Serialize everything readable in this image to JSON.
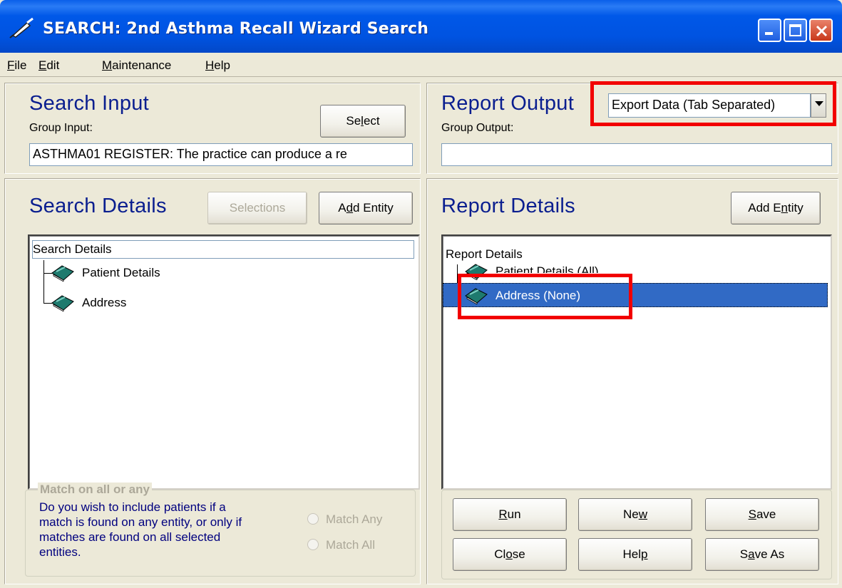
{
  "window": {
    "title": "SEARCH: 2nd Asthma Recall Wizard Search"
  },
  "menu": {
    "items": [
      {
        "label": "File",
        "mnemonic": "F",
        "rest": "ile"
      },
      {
        "label": "Edit",
        "mnemonic": "E",
        "rest": "dit"
      },
      {
        "label": "Maintenance",
        "mnemonic": "M",
        "rest": "aintenance"
      },
      {
        "label": "Help",
        "mnemonic": "H",
        "rest": "elp"
      }
    ]
  },
  "search_input": {
    "heading": "Search Input",
    "group_label": "Group Input:",
    "select_label_pre": "Se",
    "select_label_mn": "l",
    "select_label_post": "ect",
    "group_value": "ASTHMA01 REGISTER: The practice can produce a re"
  },
  "report_output": {
    "heading": "Report Output",
    "group_label": "Group Output:",
    "format_value": "Export Data (Tab Separated)",
    "group_value": ""
  },
  "search_details": {
    "heading": "Search Details",
    "selections_label": "Selections",
    "add_entity_pre": "A",
    "add_entity_mn": "d",
    "add_entity_post": "d Entity",
    "tree_root": "Search Details",
    "tree_items": [
      "Patient Details",
      "Address"
    ]
  },
  "report_details": {
    "heading": "Report Details",
    "add_entity_pre": "Add E",
    "add_entity_mn": "n",
    "add_entity_post": "tity",
    "tree_root": "Report Details",
    "tree_items": [
      "Patient Details (All)",
      "Address (None)"
    ]
  },
  "match": {
    "legend": "Match on all or any",
    "description_lines": [
      "Do you wish to include patients if a",
      "match is found on any entity, or only if",
      "matches are found on all selected",
      "entities."
    ],
    "option_any": "Match Any",
    "option_all": "Match All"
  },
  "buttons": {
    "run": {
      "mn": "R",
      "rest": "un"
    },
    "new": {
      "pre": "Ne",
      "mn": "w",
      "rest": ""
    },
    "save": {
      "mn": "S",
      "rest": "ave"
    },
    "close": {
      "pre": "Cl",
      "mn": "o",
      "rest": "se"
    },
    "help": {
      "pre": "Hel",
      "mn": "p",
      "rest": ""
    },
    "save_as": {
      "pre": "S",
      "mn": "a",
      "rest": "ve As"
    }
  },
  "colors": {
    "heading": "#0a1e8f",
    "highlight": "#f20000",
    "selection": "#316ac5"
  }
}
